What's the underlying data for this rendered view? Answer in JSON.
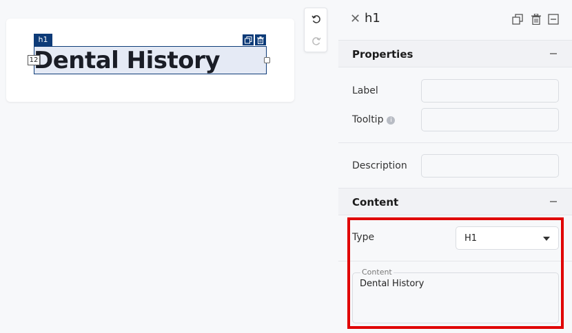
{
  "canvas": {
    "element_tag": "h1",
    "heading_text": "Dental History",
    "column_badge": "12"
  },
  "panel": {
    "title": "h1",
    "properties": {
      "section_title": "Properties",
      "label_label": "Label",
      "label_value": "",
      "tooltip_label": "Tooltip",
      "tooltip_value": "",
      "description_label": "Description",
      "description_value": ""
    },
    "content": {
      "section_title": "Content",
      "type_label": "Type",
      "type_value": "H1",
      "content_legend": "Content",
      "content_value": "Dental History"
    }
  },
  "colors": {
    "accent": "#0d3b78",
    "highlight": "#e00000"
  }
}
